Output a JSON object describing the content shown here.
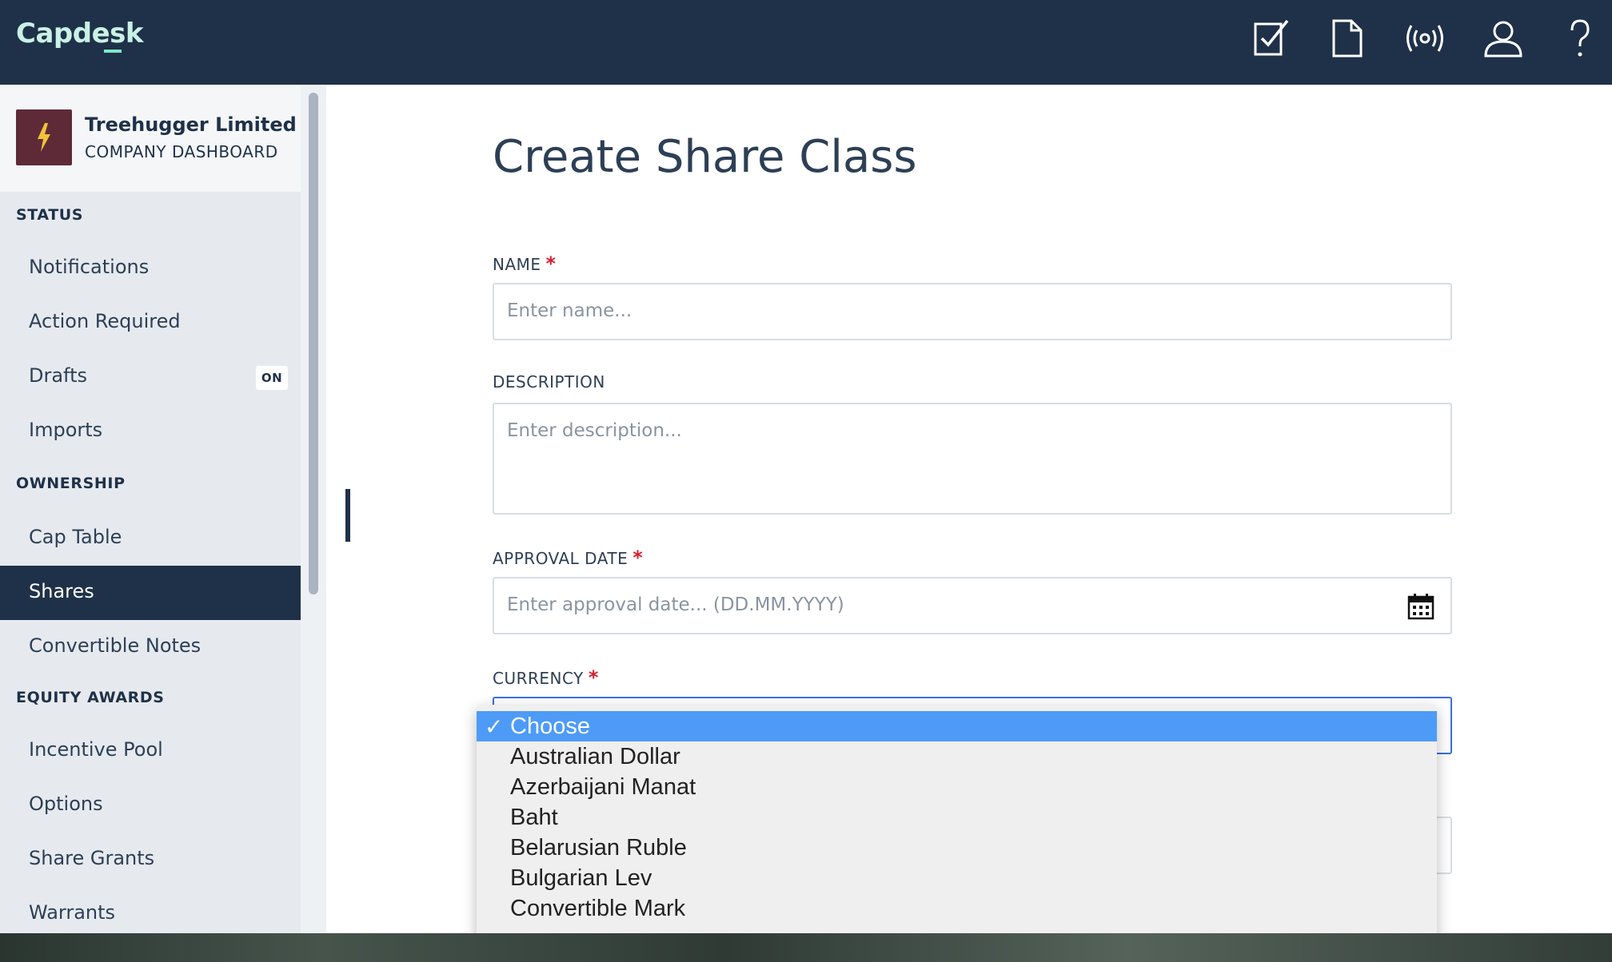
{
  "app": {
    "logo": "Capdesk",
    "colors": {
      "navy": "#1f3148",
      "accent": "#7de8c6",
      "required": "#d81e2c",
      "selected_option": "#4d9bf7"
    }
  },
  "topbar": {
    "icons": [
      "tasks-icon",
      "document-icon",
      "broadcast-icon",
      "user-icon",
      "help-icon"
    ]
  },
  "sidebar": {
    "company": {
      "name": "Treehugger Limited",
      "subtitle": "COMPANY DASHBOARD"
    },
    "sections": {
      "status": {
        "title": "STATUS",
        "items": [
          {
            "label": "Notifications"
          },
          {
            "label": "Action Required"
          },
          {
            "label": "Drafts",
            "badge": "ON"
          },
          {
            "label": "Imports"
          }
        ]
      },
      "ownership": {
        "title": "OWNERSHIP",
        "items": [
          {
            "label": "Cap Table"
          },
          {
            "label": "Shares",
            "active": true
          },
          {
            "label": "Convertible Notes"
          }
        ]
      },
      "equity_awards": {
        "title": "EQUITY AWARDS",
        "items": [
          {
            "label": "Incentive Pool"
          },
          {
            "label": "Options"
          },
          {
            "label": "Share Grants"
          },
          {
            "label": "Warrants"
          }
        ]
      }
    }
  },
  "form": {
    "title": "Create Share Class",
    "name": {
      "label": "NAME",
      "required_mark": "*",
      "placeholder": "Enter name...",
      "value": ""
    },
    "description": {
      "label": "DESCRIPTION",
      "placeholder": "Enter description...",
      "value": ""
    },
    "approval_date": {
      "label": "APPROVAL DATE",
      "required_mark": "*",
      "placeholder": "Enter approval date... (DD.MM.YYYY)",
      "value": ""
    },
    "currency": {
      "label": "CURRENCY",
      "required_mark": "*",
      "selected": "Choose",
      "check_mark": "✓",
      "options": [
        "Choose",
        "Australian Dollar",
        "Azerbaijani Manat",
        "Baht",
        "Belarusian Ruble",
        "Bulgarian Lev",
        "Convertible Mark"
      ]
    }
  }
}
